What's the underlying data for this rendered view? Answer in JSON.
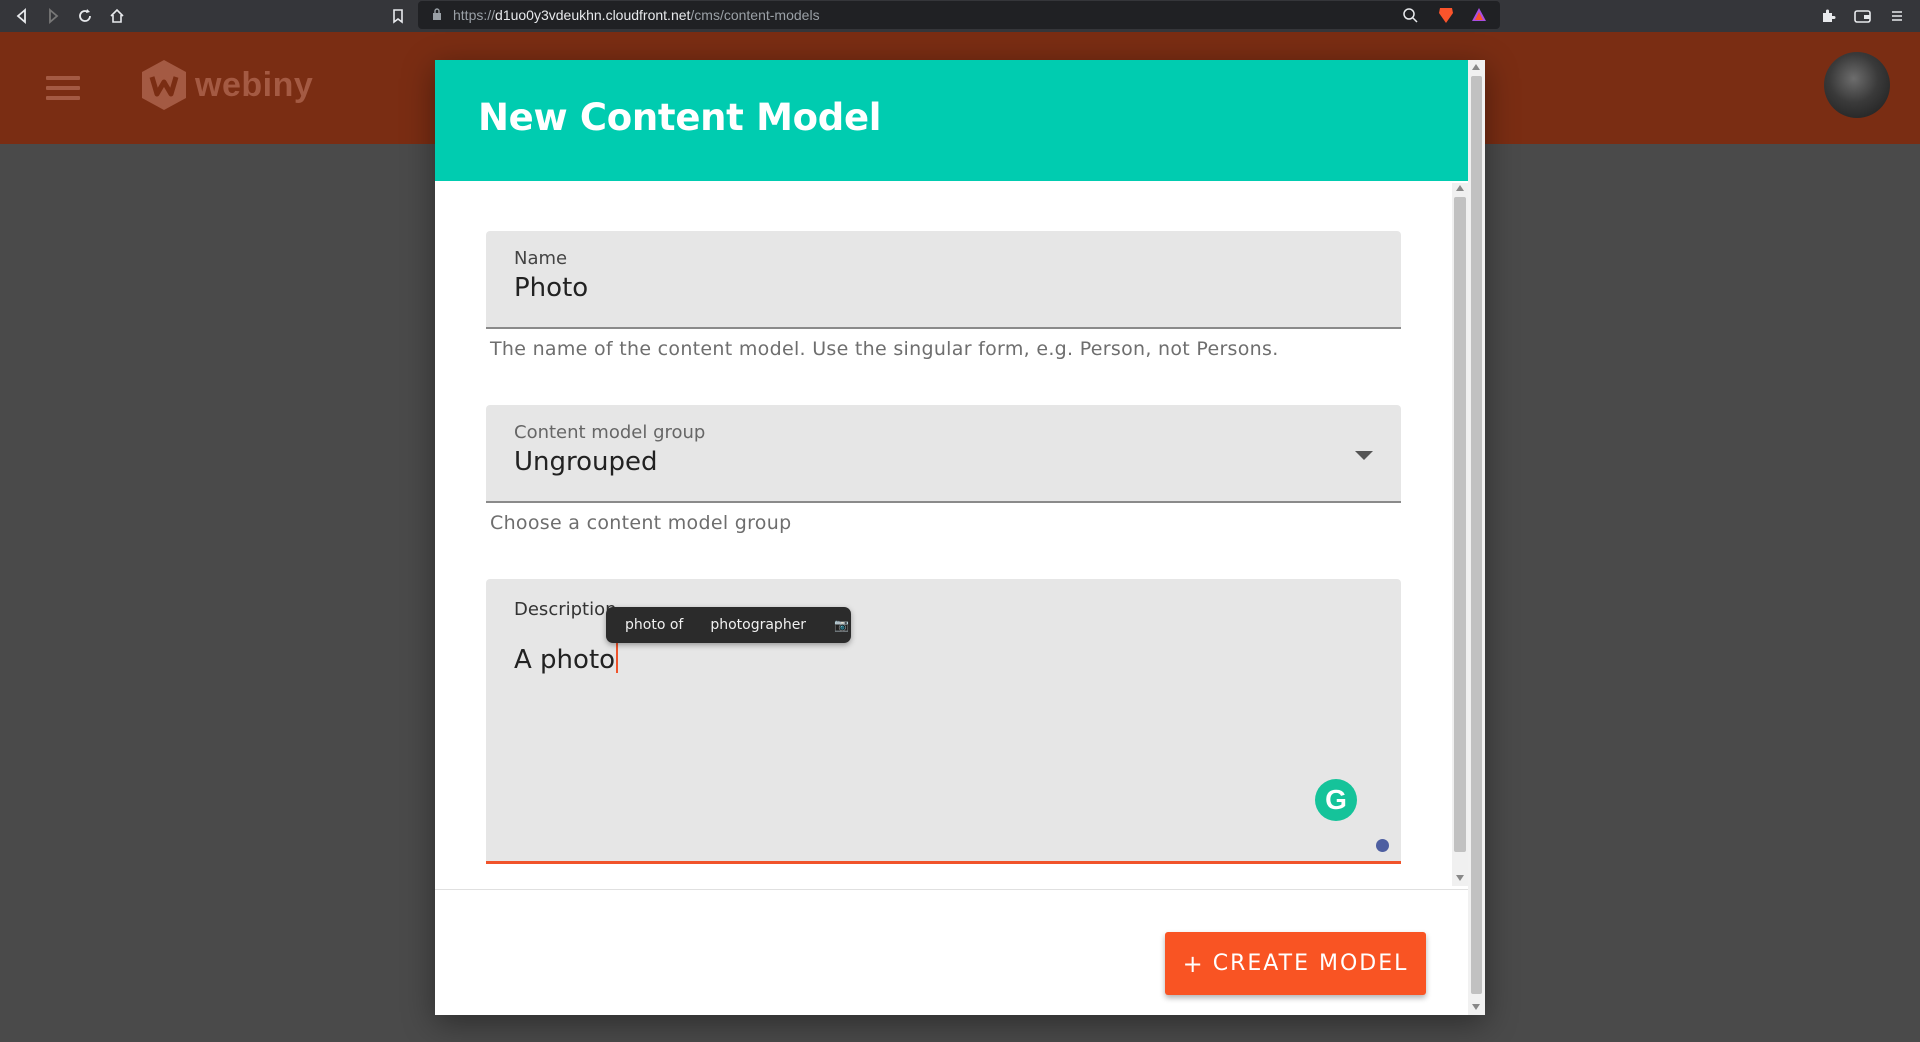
{
  "browser": {
    "url_host": "d1uo0y3vdeukhn.cloudfront.net",
    "url_prefix": "https://",
    "url_path": "/cms/content-models"
  },
  "app": {
    "logo_text": "webiny",
    "brand_color": "#fa5723"
  },
  "modal": {
    "title": "New Content Model",
    "header_color": "#00ccb0",
    "name_field": {
      "label": "Name",
      "value": "Photo",
      "helper": "The name of the content model. Use the singular form, e.g. Person, not Persons."
    },
    "group_field": {
      "label": "Content model group",
      "value": "Ungrouped",
      "helper": "Choose a content model group"
    },
    "description_field": {
      "label": "Description",
      "value": "A photo"
    },
    "suggestions": {
      "items": [
        "photo of",
        "photographer",
        "📷"
      ]
    },
    "create_button": {
      "plus": "+",
      "label": "CREATE MODEL"
    }
  },
  "icons": {
    "grammarly": "G"
  }
}
